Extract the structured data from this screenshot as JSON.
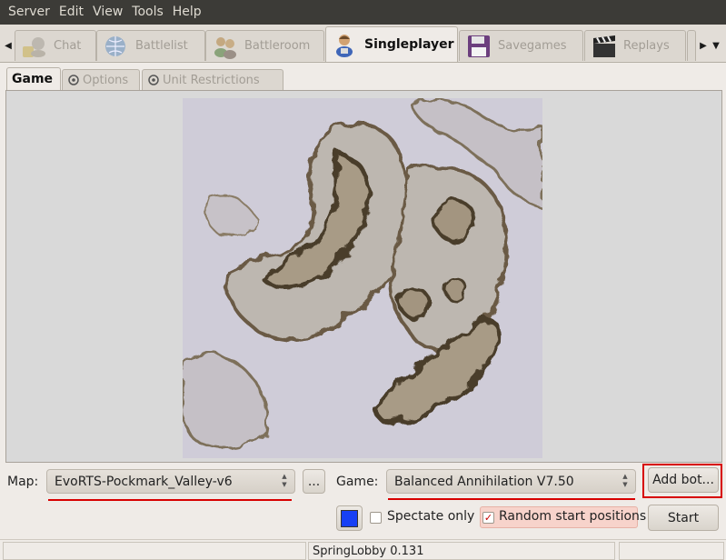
{
  "menu": [
    "Server",
    "Edit",
    "View",
    "Tools",
    "Help"
  ],
  "tabs": [
    {
      "label": "Chat",
      "icon": "chat-icon"
    },
    {
      "label": "Battlelist",
      "icon": "globe-icon"
    },
    {
      "label": "Battleroom",
      "icon": "users-icon"
    },
    {
      "label": "Singleplayer",
      "icon": "singleplayer-icon",
      "active": true
    },
    {
      "label": "Savegames",
      "icon": "floppy-disk-icon"
    },
    {
      "label": "Replays",
      "icon": "clapperboard-icon"
    }
  ],
  "subtabs": [
    {
      "label": "Game",
      "active": true
    },
    {
      "label": "Options",
      "icon": "options-icon"
    },
    {
      "label": "Unit Restrictions",
      "icon": "restrictions-icon"
    }
  ],
  "map": {
    "label": "Map:",
    "value": "EvoRTS-Pockmark_Valley-v6",
    "browse_label": "..."
  },
  "game": {
    "label": "Game:",
    "value": "Balanced Annihilation V7.50"
  },
  "add_bot_label": "Add bot...",
  "spectate_label": "Spectate only",
  "spectate_checked": false,
  "random_start_label": "Random start positions",
  "random_start_checked": true,
  "start_label": "Start",
  "color_swatch": "#1740f5",
  "status_text": "SpringLobby 0.131",
  "colors": {
    "menubar": "#3c3b37",
    "highlight": "#d70000"
  }
}
